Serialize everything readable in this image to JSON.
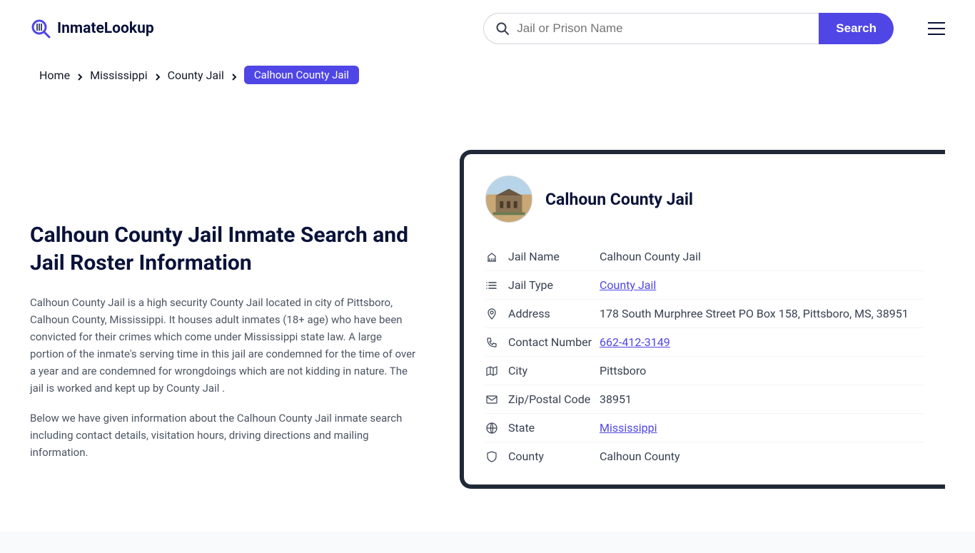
{
  "logo": {
    "text": "InmateLookup"
  },
  "search": {
    "placeholder": "Jail or Prison Name",
    "button": "Search"
  },
  "breadcrumb": {
    "items": [
      "Home",
      "Mississippi",
      "County Jail"
    ],
    "current": "Calhoun County Jail"
  },
  "page": {
    "title": "Calhoun County Jail Inmate Search and Jail Roster Information",
    "paragraph1": "Calhoun County Jail is a high security County Jail located in city of Pittsboro, Calhoun County, Mississippi. It houses adult inmates (18+ age) who have been convicted for their crimes which come under Mississippi state law. A large portion of the inmate's serving time in this jail are condemned for the time of over a year and are condemned for wrongdoings which are not kidding in nature. The jail is worked and kept up by County Jail .",
    "paragraph2": "Below we have given information about the Calhoun County Jail inmate search including contact details, visitation hours, driving directions and mailing information."
  },
  "card": {
    "title": "Calhoun County Jail",
    "rows": [
      {
        "label": "Jail Name",
        "value": "Calhoun County Jail",
        "link": false
      },
      {
        "label": "Jail Type",
        "value": "County Jail",
        "link": true
      },
      {
        "label": "Address",
        "value": "178 South Murphree Street PO Box 158, Pittsboro, MS, 38951",
        "link": false
      },
      {
        "label": "Contact Number",
        "value": "662-412-3149",
        "link": true
      },
      {
        "label": "City",
        "value": "Pittsboro",
        "link": false
      },
      {
        "label": "Zip/Postal Code",
        "value": "38951",
        "link": false
      },
      {
        "label": "State",
        "value": "Mississippi",
        "link": true
      },
      {
        "label": "County",
        "value": "Calhoun County",
        "link": false
      }
    ]
  }
}
